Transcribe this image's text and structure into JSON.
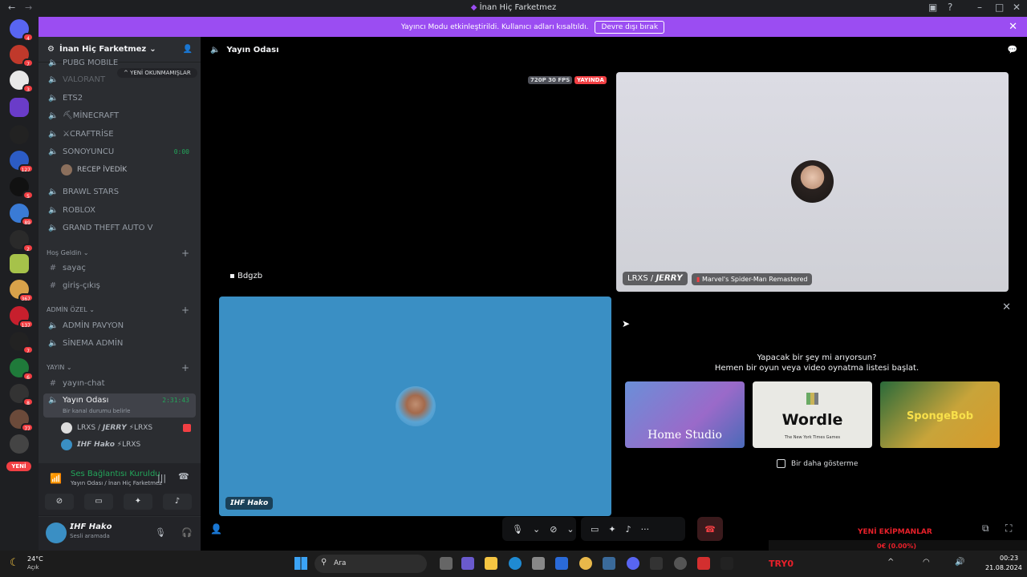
{
  "window": {
    "title": "İnan Hiç Farketmez",
    "back": "←",
    "forward": "→"
  },
  "banner": {
    "text": "Yayıncı Modu etkinleştirildi. Kullanıcı adları kısaltıldı.",
    "button": "Devre dışı bırak"
  },
  "servers": {
    "badges": [
      "4",
      "7",
      "3",
      "",
      "",
      "127",
      "5",
      "89",
      "2",
      "",
      "367",
      "137",
      "7",
      "6",
      "8",
      "77"
    ],
    "new_label": "YENİ"
  },
  "guild": {
    "name": "İnan Hiç Farketmez",
    "unread_pill": "YENİ OKUNMAMIŞLAR",
    "channels": [
      {
        "icon": "speaker-icon",
        "label": "PUBG MOBILE"
      },
      {
        "icon": "speaker-icon",
        "label": "VALORANT"
      },
      {
        "icon": "speaker-icon",
        "label": "ETS2"
      },
      {
        "icon": "speaker-icon",
        "label": "⛏MİNECRAFT"
      },
      {
        "icon": "speaker-icon",
        "label": "⚔CRAFTRİSE"
      },
      {
        "icon": "speaker-icon",
        "label": "SONOYUNCU",
        "timer": "0:00"
      },
      {
        "icon": "speaker-icon",
        "label": "BRAWL STARS"
      },
      {
        "icon": "speaker-icon",
        "label": "ROBLOX"
      },
      {
        "icon": "speaker-icon",
        "label": "GRAND THEFT AUTO V"
      }
    ],
    "sonoyuncu_user": "RECEP İVEDİK",
    "categories": [
      {
        "label": "Hoş Geldin"
      },
      {
        "label": "ADMİN ÖZEL"
      },
      {
        "label": "YAYIN"
      }
    ],
    "welcome_channels": [
      "sayaç",
      "giriş-çıkış"
    ],
    "admin_channels": [
      "ADMİN PAVYON",
      "SİNEMA ADMİN"
    ],
    "stream_channels": {
      "chat": "yayın-chat",
      "room": "Yayın Odası",
      "room_timer": "2:31:43",
      "room_status": "Bir kanal durumu belirle",
      "users": [
        "LRXS / 𝙅𝙀𝙍𝙍𝙔 ⚡LRXS",
        "𝙄𝙃𝙁 𝙃𝙖𝙠𝙤 ⚡LRXS"
      ]
    }
  },
  "voice": {
    "status": "Ses Bağlantısı Kuruldu",
    "location": "Yayın Odası / İnan Hiç Farketmez"
  },
  "me": {
    "name": "𝙄𝙃𝙁 𝙃𝙖𝙠𝙤",
    "status": "Sesli aramada"
  },
  "stage": {
    "channel_title": "Yayın Odası",
    "quality": "720P 30 FPS",
    "live": "YAYINDA",
    "stream_user": "Bdgzb",
    "jerry_label": "LRXS / 𝙅𝙀𝙍𝙍𝙔",
    "jerry_game": "Marvel's Spider-Man Remastered",
    "hako_label": "𝙄𝙃𝙁 𝙃𝙖𝙠𝙤"
  },
  "activity": {
    "question_line1": "Yapacak bir şey mi arıyorsun?",
    "question_line2": "Hemen bir oyun veya video oynatma listesi başlat.",
    "games": [
      "Home Studio",
      "Wordle",
      "SpongeBob"
    ],
    "wordle_sub": "The New York Times Games",
    "dont_show": "Bir daha gösterme"
  },
  "overlay": {
    "title": "YENİ EKİPMANLAR",
    "value": "0€ (0.00%)",
    "tag": "TRY0"
  },
  "taskbar": {
    "weather_temp": "24°C",
    "weather_desc": "Açık",
    "search": "Ara",
    "time": "00:23",
    "date": "21.08.2024"
  },
  "colors": {
    "banner": "#9b4df2",
    "voice_green": "#23a55a",
    "tile_blue": "#3a8fc4",
    "tile_grey": "#d6d6dd",
    "sidebar": "#2b2d31"
  }
}
